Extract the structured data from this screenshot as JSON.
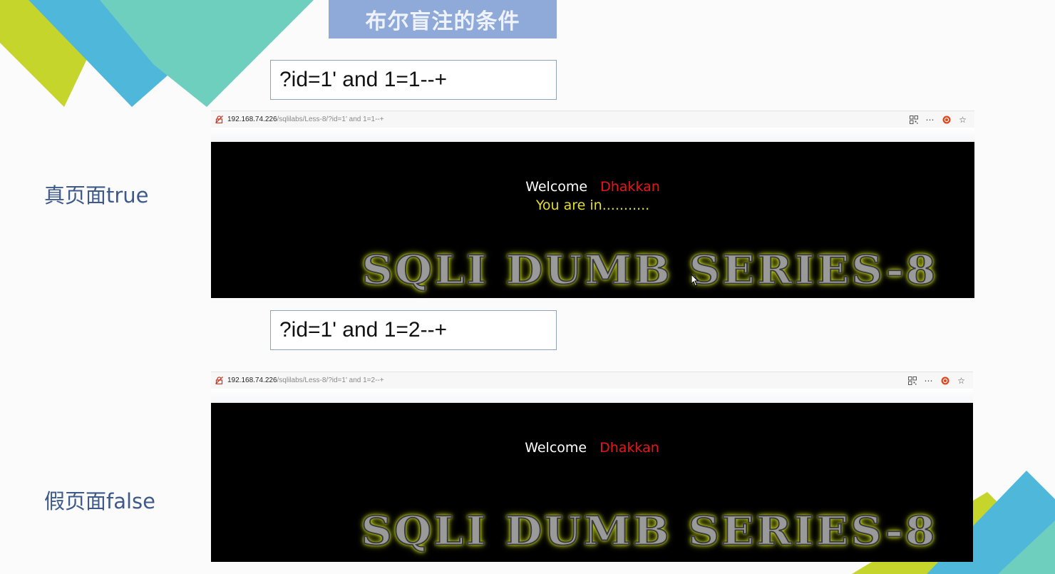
{
  "title": "布尔盲注的条件",
  "true_case": {
    "query": "?id=1' and 1=1--+",
    "label": "真页面true",
    "address": {
      "host": "192.168.74.226",
      "path": "/sqlilabs/Less-8/?id=1' and 1=1--+"
    },
    "welcome": "Welcome",
    "name": "Dhakkan",
    "message": "You are in...........",
    "banner": "SQLI DUMB SERIES-8"
  },
  "false_case": {
    "query": "?id=1' and 1=2--+",
    "label": "假页面false",
    "address": {
      "host": "192.168.74.226",
      "path": "/sqlilabs/Less-8/?id=1' and 1=2--+"
    },
    "welcome": "Welcome",
    "name": "Dhakkan",
    "banner": "SQLI DUMB SERIES-8"
  },
  "toolbar_icons": [
    "qr-code-icon",
    "more-icon",
    "ubuntu-icon",
    "star-icon"
  ],
  "colors": {
    "title_bg": "#8fa9d9",
    "label_text": "#3e5a8c",
    "name_red": "#e8141a",
    "message_yellow": "#e3de2c",
    "deco_green": "#c5d52b",
    "deco_blue": "#4fb8da",
    "deco_teal": "#6fcfbf"
  }
}
